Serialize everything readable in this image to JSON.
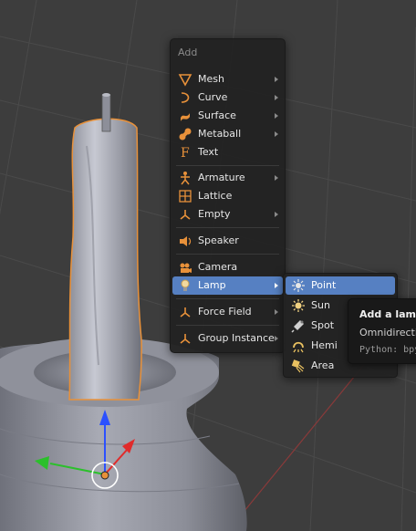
{
  "add_menu": {
    "title": "Add",
    "items": [
      {
        "label": "Mesh",
        "icon": "mesh-icon",
        "submenu": true
      },
      {
        "label": "Curve",
        "icon": "curve-icon",
        "submenu": true
      },
      {
        "label": "Surface",
        "icon": "surface-icon",
        "submenu": true
      },
      {
        "label": "Metaball",
        "icon": "metaball-icon",
        "submenu": true
      },
      {
        "label": "Text",
        "icon": "text-icon",
        "submenu": false
      },
      {
        "label": "Armature",
        "icon": "armature-icon",
        "submenu": true
      },
      {
        "label": "Lattice",
        "icon": "lattice-icon",
        "submenu": false
      },
      {
        "label": "Empty",
        "icon": "empty-icon",
        "submenu": true
      },
      {
        "label": "Speaker",
        "icon": "speaker-icon",
        "submenu": false
      },
      {
        "label": "Camera",
        "icon": "camera-icon",
        "submenu": false
      },
      {
        "label": "Lamp",
        "icon": "lamp-icon",
        "submenu": true,
        "active": true
      },
      {
        "label": "Force Field",
        "icon": "force-field-icon",
        "submenu": true
      },
      {
        "label": "Group Instance",
        "icon": "group-instance-icon",
        "submenu": true
      }
    ]
  },
  "lamp_submenu": {
    "items": [
      {
        "label": "Point",
        "icon": "point-lamp-icon",
        "active": true
      },
      {
        "label": "Sun",
        "icon": "sun-lamp-icon"
      },
      {
        "label": "Spot",
        "icon": "spot-lamp-icon"
      },
      {
        "label": "Hemi",
        "icon": "hemi-lamp-icon"
      },
      {
        "label": "Area",
        "icon": "area-lamp-icon"
      }
    ]
  },
  "tooltip": {
    "title": "Add a lamp o",
    "description": "Omnidirectio",
    "python": "Python: bpy"
  },
  "colors": {
    "background": "#3d3d3d",
    "menu_bg": "#222222",
    "highlight": "#5680c2",
    "selection_outline": "#e8913a",
    "icon_orange": "#e8913a"
  }
}
